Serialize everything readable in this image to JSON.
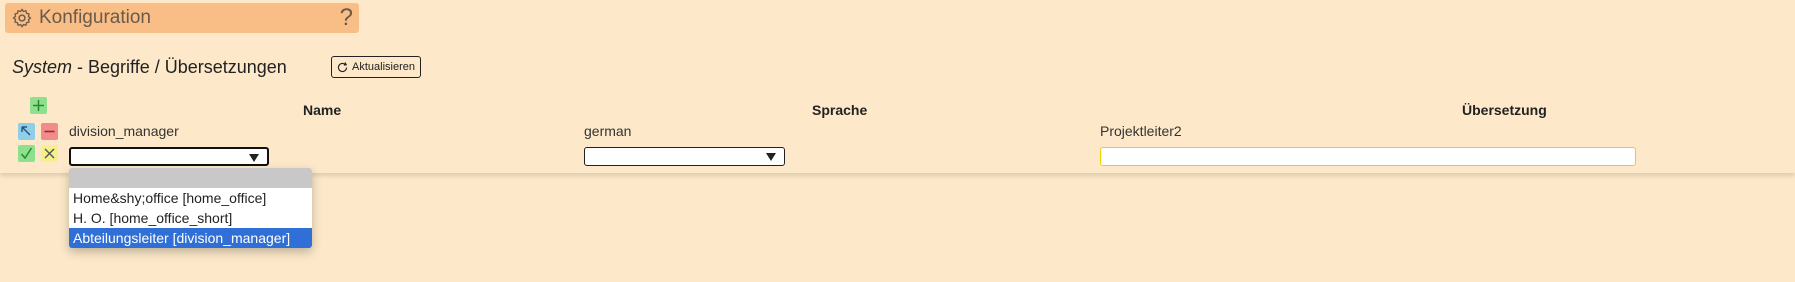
{
  "header": {
    "title": "Konfiguration",
    "help_glyph": "?"
  },
  "page": {
    "heading_system": "System",
    "heading_rest": " - Begriffe / Übersetzungen",
    "refresh_label": "Aktualisieren"
  },
  "table": {
    "columns": [
      "Name",
      "Sprache",
      "Übersetzung"
    ],
    "row": {
      "name": "division_manager",
      "language": "german",
      "translation": "Projektleiter2"
    }
  },
  "edit_row": {
    "name_value": "",
    "language_value": "",
    "translation_value": ""
  },
  "dropdown": {
    "options": [
      "",
      "Home&shy;office [home_office]",
      "H. O. [home_office_short]",
      "Abteilungsleiter [division_manager]"
    ],
    "selected_index": 3
  },
  "colors": {
    "background": "#fde9c9",
    "header_bar": "#f9bd86",
    "add": "#8ee08e",
    "delete": "#f08c8c",
    "edit": "#8fcde8",
    "confirm": "#8ee08e",
    "cancel": "#f5ef8c",
    "selected_option": "#2f6fd6"
  },
  "icons": [
    "gear-icon",
    "help-icon",
    "refresh-icon",
    "add-icon",
    "edit-icon",
    "delete-icon",
    "confirm-icon",
    "cancel-icon",
    "dropdown-arrow-icon"
  ]
}
